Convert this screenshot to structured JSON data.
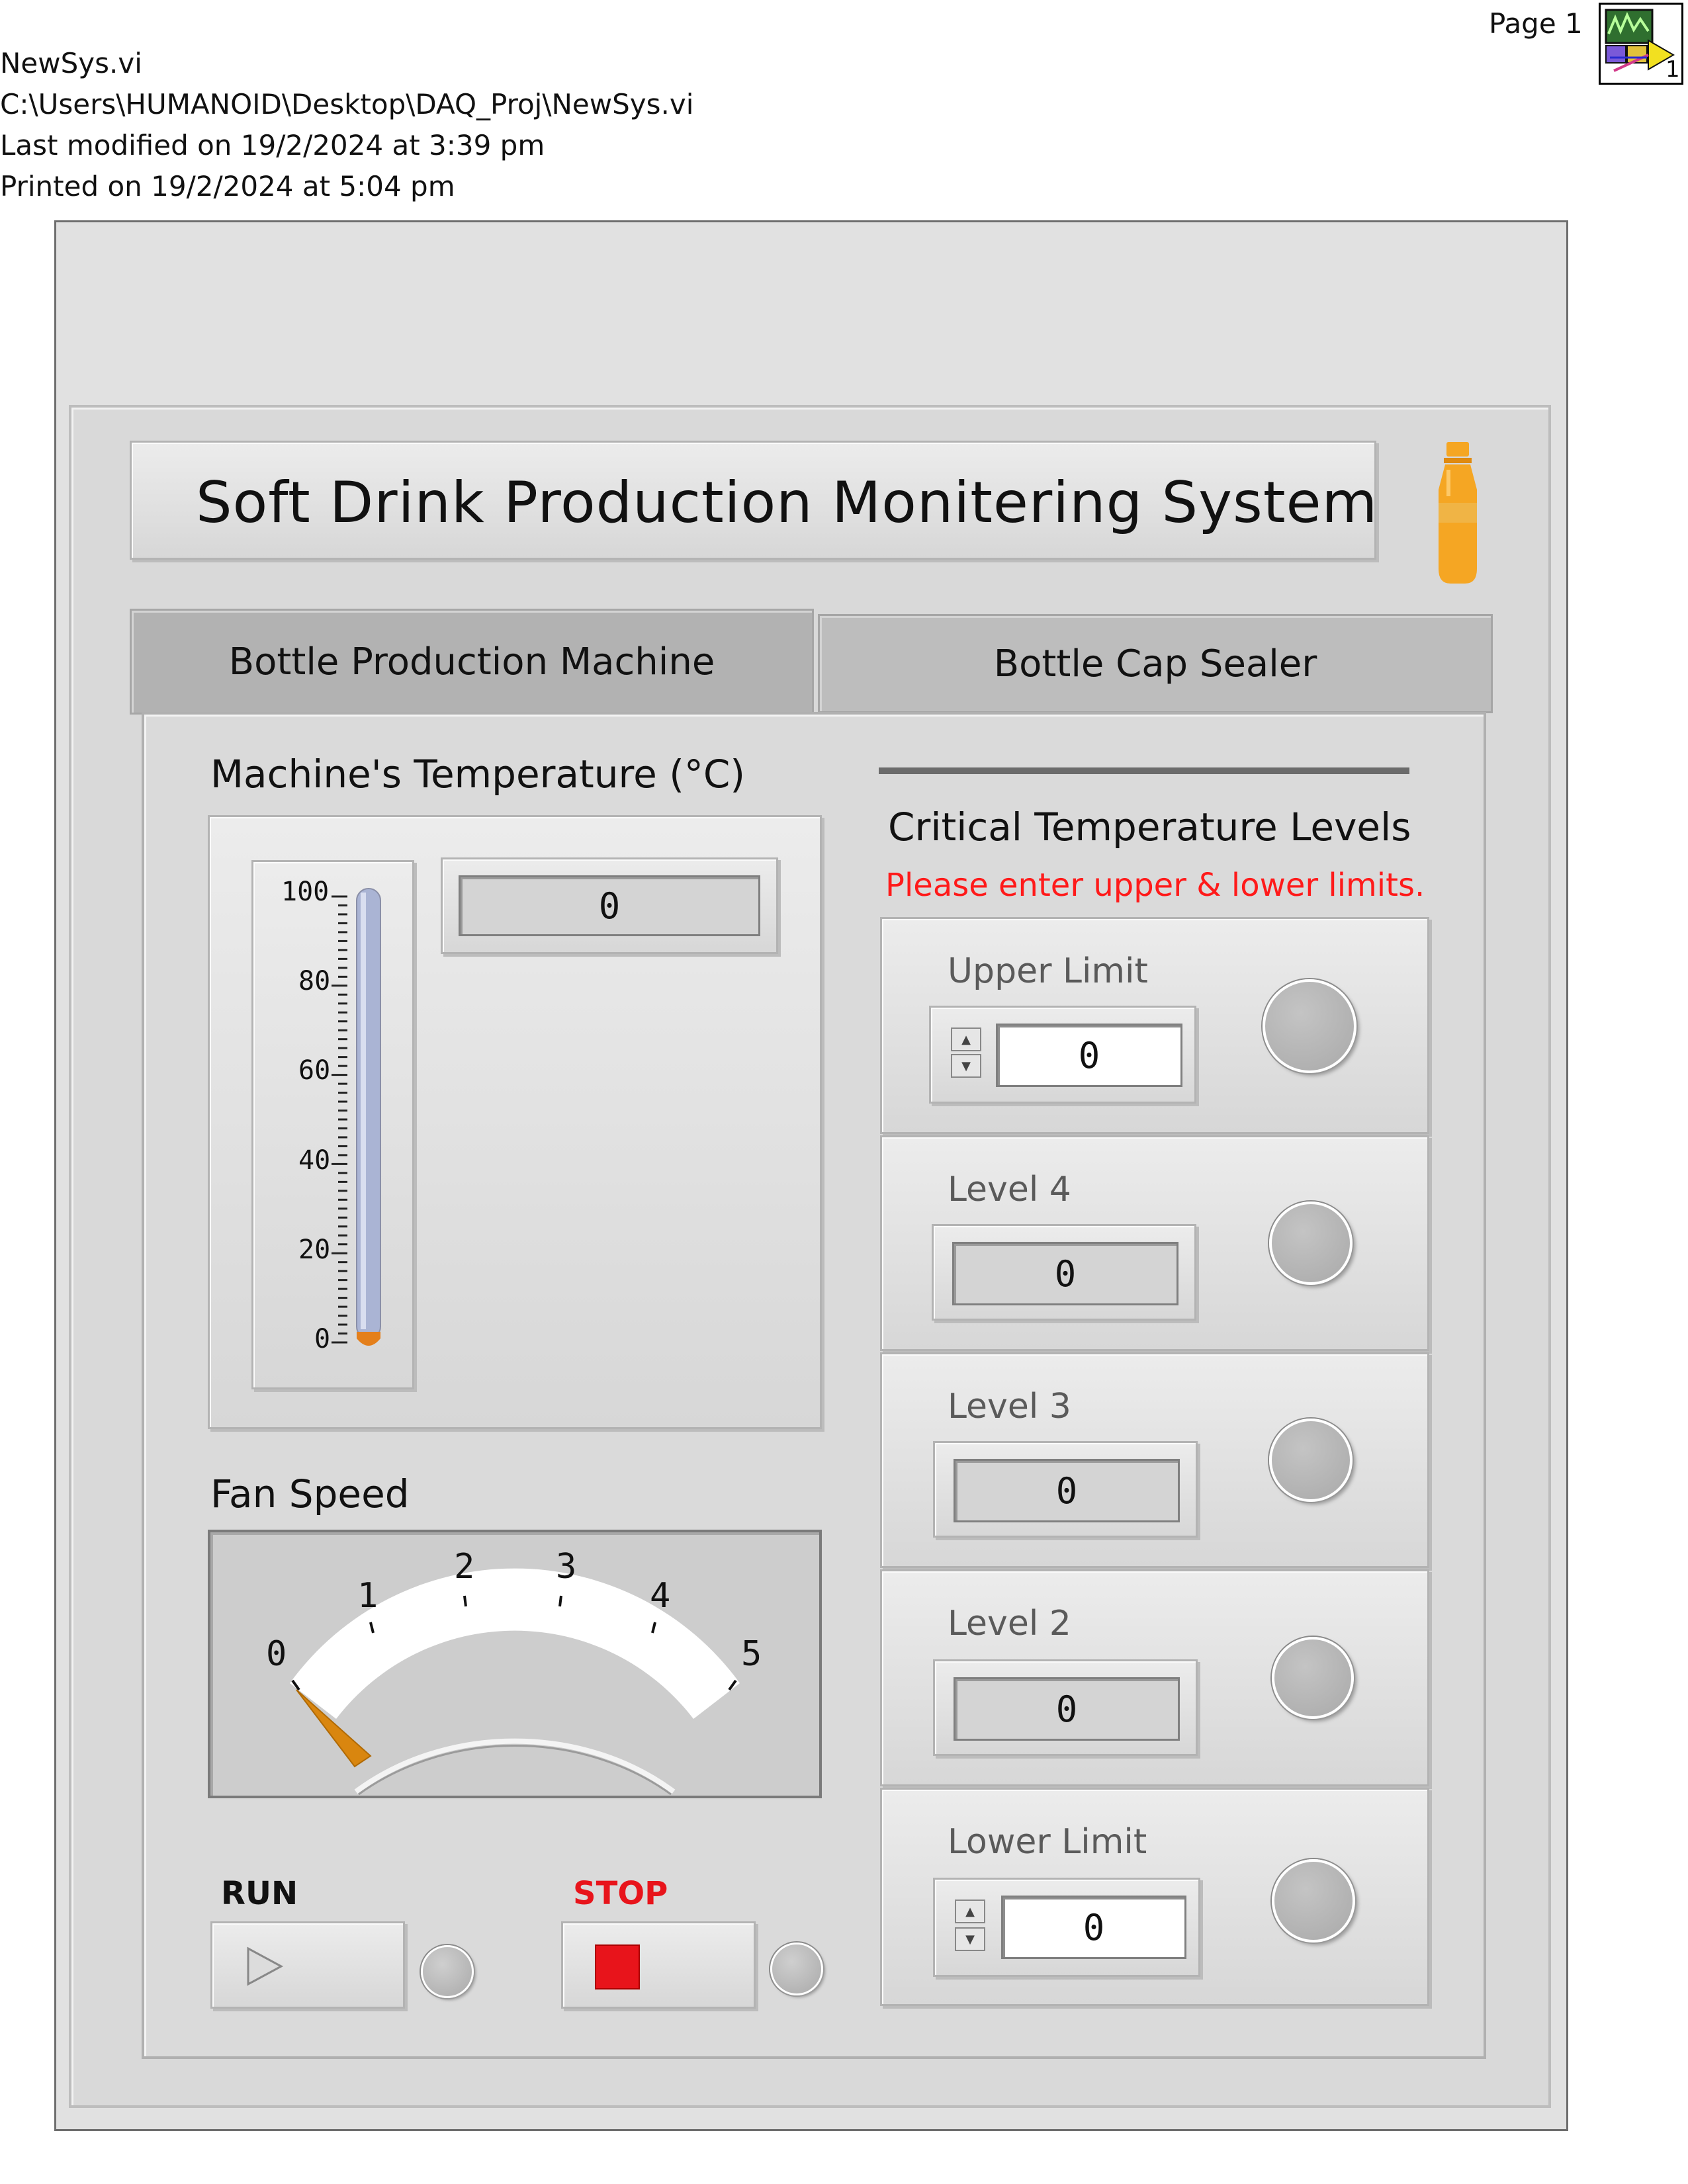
{
  "print_header": {
    "page_label": "Page 1",
    "vi_name": "NewSys.vi",
    "vi_path": "C:\\Users\\HUMANOID\\Desktop\\DAQ_Proj\\NewSys.vi",
    "last_modified": "Last modified on 19/2/2024 at 3:39 pm",
    "printed_on": "Printed on 19/2/2024 at 5:04 pm",
    "icon_number": "1"
  },
  "title": "Soft Drink Production Monitering System",
  "tabs": [
    {
      "label": "Bottle Production Machine",
      "selected": true
    },
    {
      "label": "Bottle Cap Sealer",
      "selected": false
    }
  ],
  "temperature": {
    "label": "Machine's Temperature (°C)",
    "value": "0",
    "level": 0,
    "scale": [
      "100",
      "80",
      "60",
      "40",
      "20",
      "0"
    ]
  },
  "fan_speed": {
    "label": "Fan Speed",
    "value": 0,
    "scale": [
      "0",
      "1",
      "2",
      "3",
      "4",
      "5"
    ]
  },
  "critical": {
    "title": "Critical Temperature Levels",
    "instruction": "Please enter upper & lower limits.",
    "levels": [
      {
        "label": "Upper Limit",
        "value": "0",
        "control": true
      },
      {
        "label": "Level 4",
        "value": "0",
        "control": false
      },
      {
        "label": "Level 3",
        "value": "0",
        "control": false
      },
      {
        "label": "Level 2",
        "value": "0",
        "control": false
      },
      {
        "label": "Lower Limit",
        "value": "0",
        "control": true
      }
    ]
  },
  "buttons": {
    "run_label": "RUN",
    "stop_label": "STOP"
  },
  "colors": {
    "accent_orange": "#f5a623",
    "stop_red": "#e8141b",
    "instruction_red": "#ff1a1a",
    "thermometer_fill": "#aab4d4"
  },
  "icons": [
    "vi-icon",
    "bottle-icon",
    "play-icon",
    "stop-square-icon",
    "spin-up-icon",
    "spin-down-icon"
  ]
}
